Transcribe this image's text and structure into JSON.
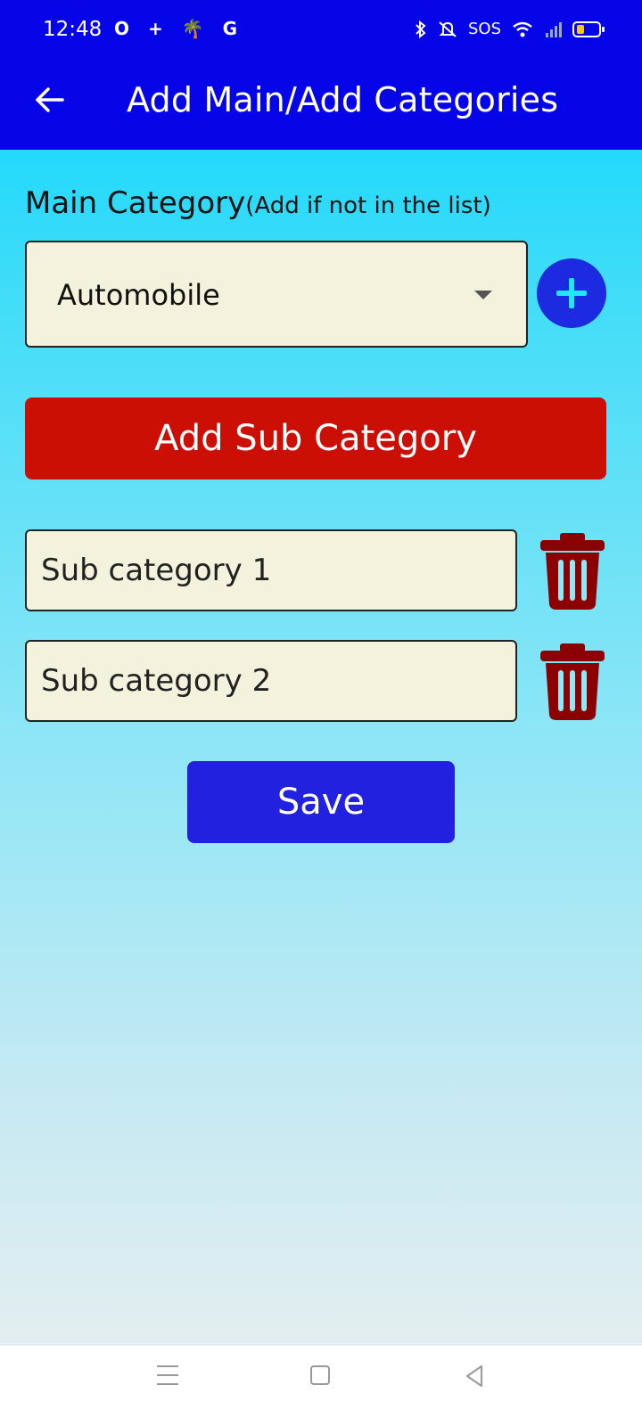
{
  "status_bar": {
    "time": "12:48",
    "left_icons": [
      "O",
      "+",
      "🌴",
      "G"
    ],
    "sos": "SOS"
  },
  "app_bar": {
    "title": "Add Main/Add Categories"
  },
  "form": {
    "main_category_label": "Main Category",
    "main_category_hint": "(Add if not in the list)",
    "selected_category": "Automobile",
    "add_sub_category_label": "Add Sub Category",
    "sub_categories": [
      {
        "value": "Sub category 1"
      },
      {
        "value": "Sub category 2"
      }
    ],
    "save_label": "Save"
  },
  "colors": {
    "app_bar": "#0505e8",
    "add_sub_button": "#cc0f04",
    "save_button": "#2221e0",
    "trash": "#8b0000",
    "input_bg": "#f3f3dd"
  }
}
